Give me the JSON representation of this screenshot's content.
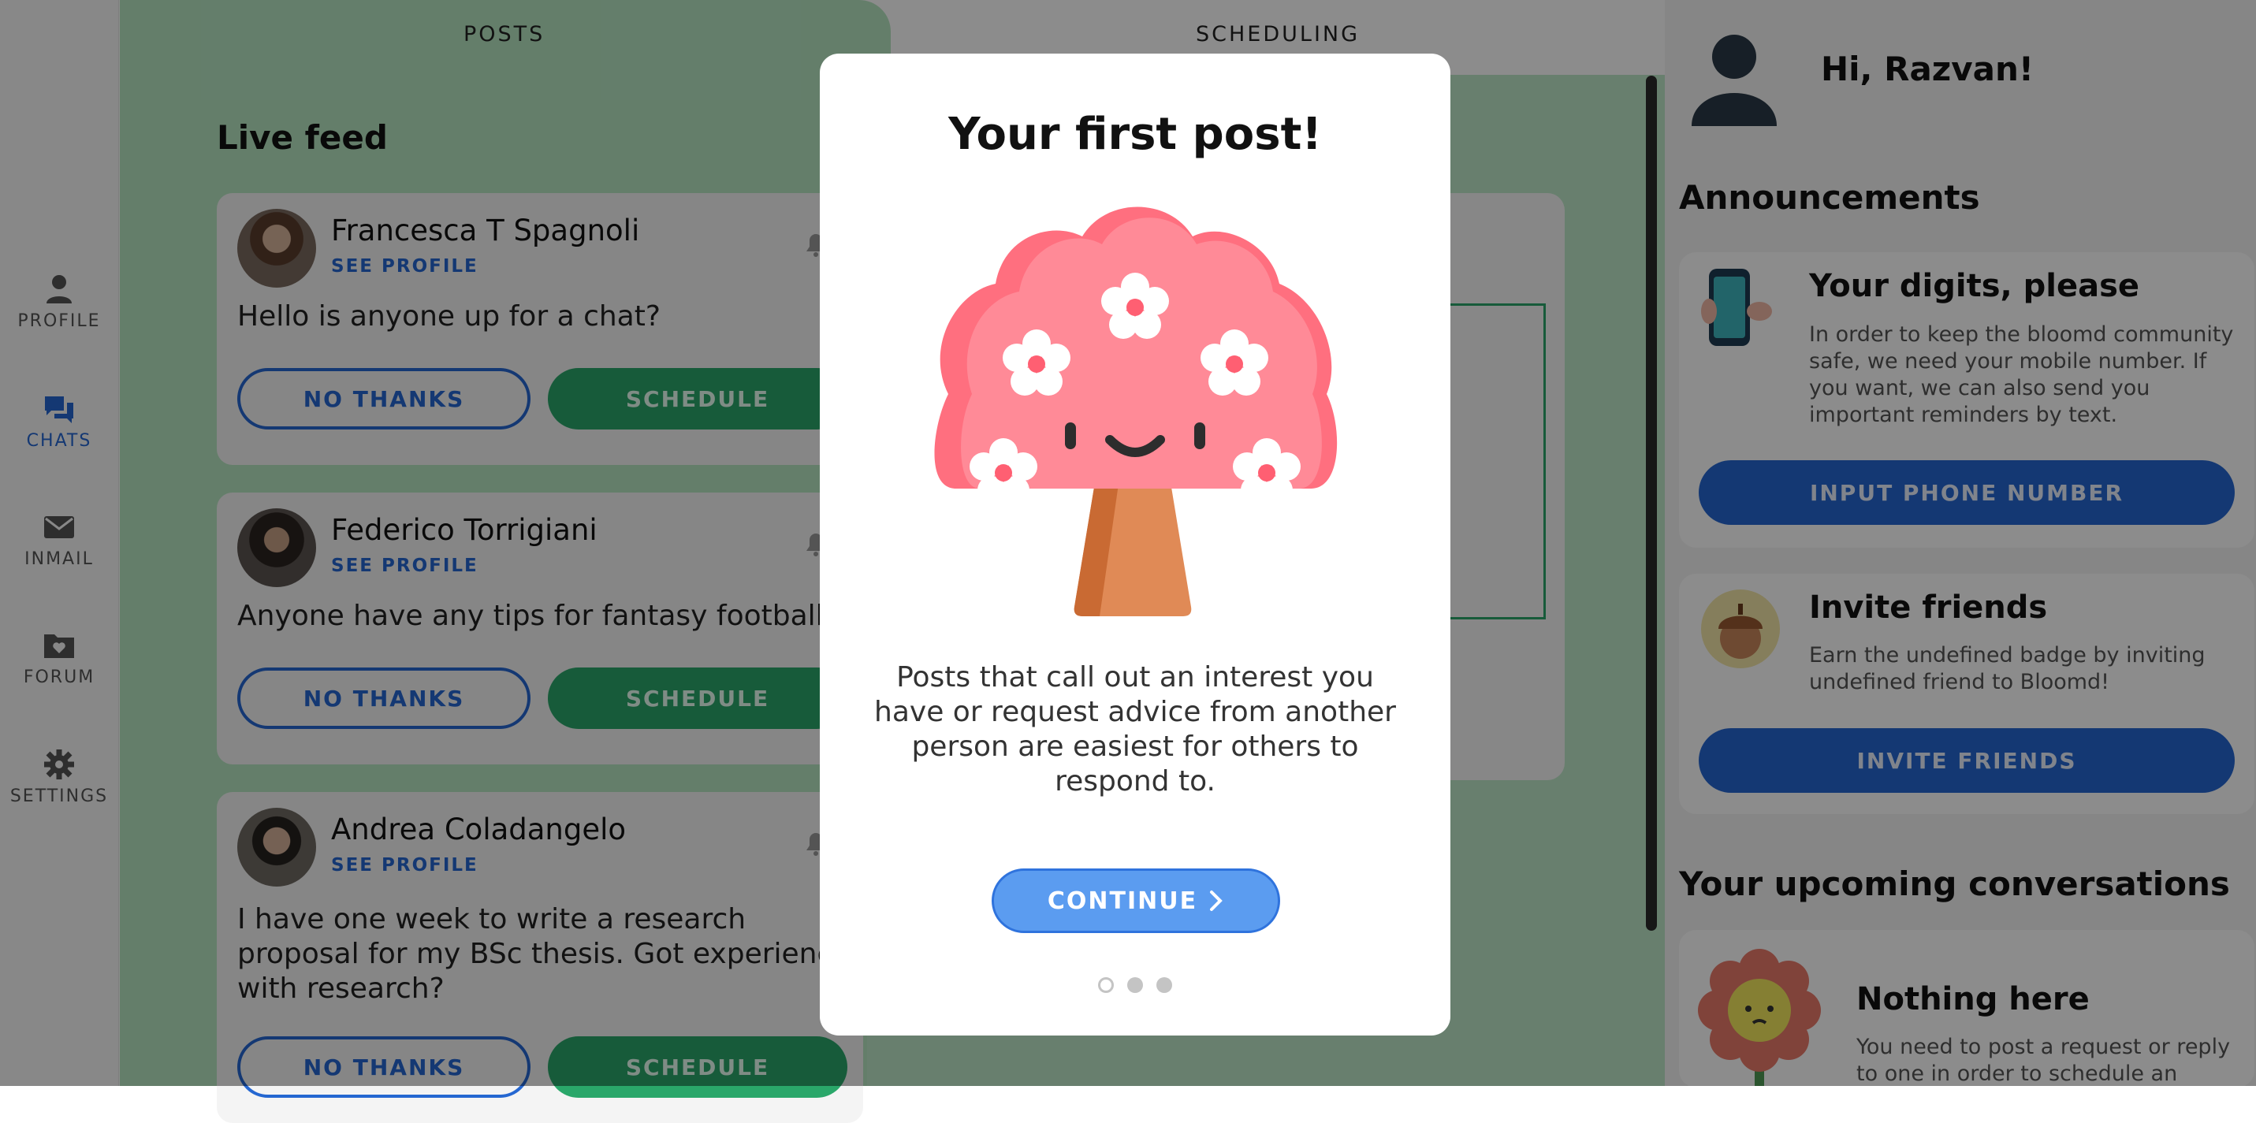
{
  "nav": {
    "items": [
      {
        "label": "PROFILE",
        "icon": "person-icon",
        "active": false
      },
      {
        "label": "CHATS",
        "icon": "chat-bubbles-icon",
        "active": true
      },
      {
        "label": "INMAIL",
        "icon": "envelope-icon",
        "active": false
      },
      {
        "label": "FORUM",
        "icon": "folder-heart-icon",
        "active": false
      },
      {
        "label": "SETTINGS",
        "icon": "gear-icon",
        "active": false
      }
    ]
  },
  "tabs": {
    "posts": "POSTS",
    "scheduling": "SCHEDULING"
  },
  "feed": {
    "title": "Live feed",
    "see_profile": "SEE PROFILE",
    "no_thanks": "NO THANKS",
    "schedule": "SCHEDULE",
    "posts": [
      {
        "name": "Francesca T Spagnoli",
        "message": "Hello is anyone up for a chat?"
      },
      {
        "name": "Federico Torrigiani",
        "message": "Anyone have any tips for fantasy football"
      },
      {
        "name": "Andrea Coladangelo",
        "message": "I have one week to write a research proposal for my BSc thesis. Got experience with research?"
      }
    ]
  },
  "sidebar": {
    "greeting": "Hi, Razvan!",
    "announcements_title": "Announcements",
    "digits": {
      "title": "Your digits, please",
      "text": "In order to keep the bloomd community safe, we need your mobile number. If you want, we can also send you important reminders by text.",
      "button": "INPUT PHONE NUMBER"
    },
    "invite": {
      "title": "Invite friends",
      "text": "Earn the undefined badge by inviting undefined friend to Bloomd!",
      "button": "INVITE FRIENDS"
    },
    "upcoming_title": "Your upcoming conversations",
    "empty": {
      "title": "Nothing here",
      "text": "You need to post a request or reply to one in order to schedule an"
    }
  },
  "modal": {
    "title": "Your first post!",
    "body": "Posts that call out an interest you have or request advice from another person are easiest for others to respond to.",
    "continue": "CONTINUE",
    "page_count": 3,
    "current_page": 1
  },
  "colors": {
    "brand_green": "#2aa76a",
    "brand_blue": "#2567d1",
    "tree_pink": "#ff8a97",
    "continue_blue": "#5b9cf0"
  }
}
